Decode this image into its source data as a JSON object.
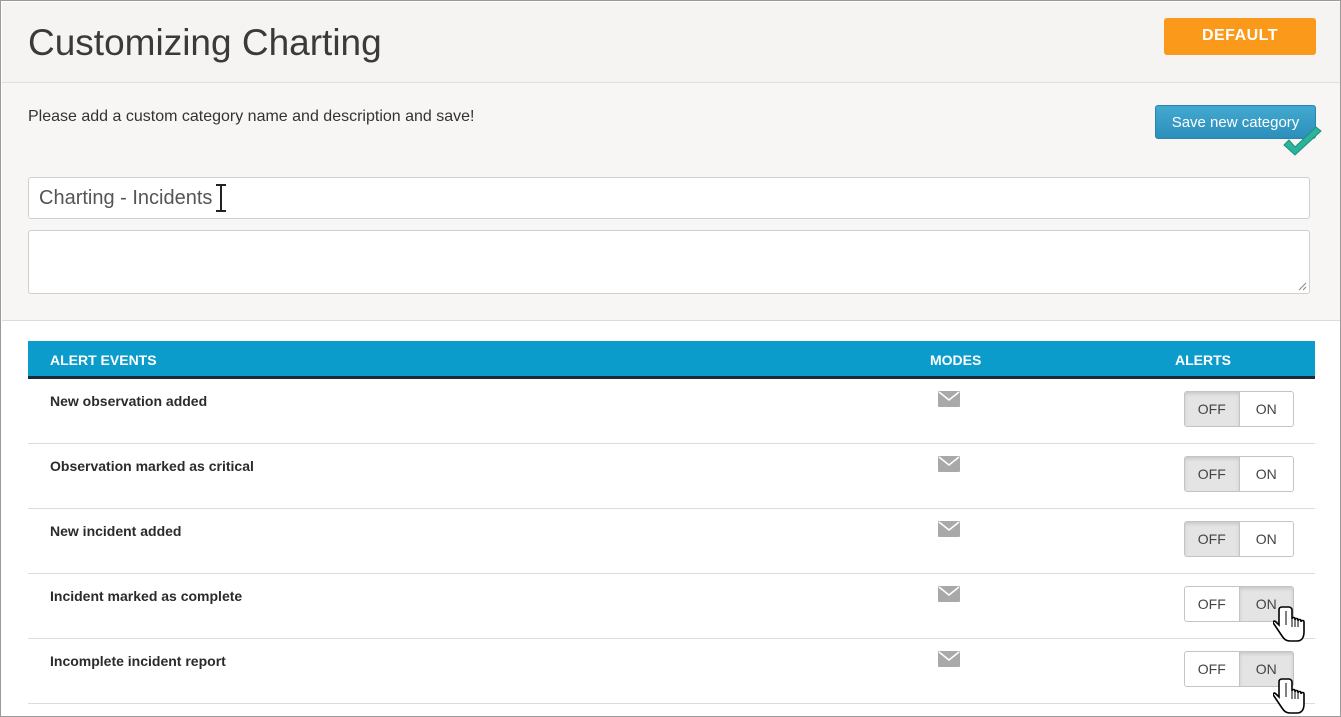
{
  "header": {
    "title": "Customizing Charting",
    "default_button": "DEFAULT"
  },
  "form": {
    "instructions": "Please add a custom category name and description and save!",
    "save_button": "Save new category",
    "name_value": "Charting - Incidents",
    "description_value": ""
  },
  "table": {
    "columns": {
      "events": "ALERT EVENTS",
      "modes": "MODES",
      "alerts": "ALERTS"
    },
    "rows": [
      {
        "label": "New observation added",
        "mode_icon": "envelope-icon",
        "off_label": "OFF",
        "on_label": "ON",
        "selected": "OFF"
      },
      {
        "label": "Observation marked as critical",
        "mode_icon": "envelope-icon",
        "off_label": "OFF",
        "on_label": "ON",
        "selected": "OFF"
      },
      {
        "label": "New incident added",
        "mode_icon": "envelope-icon",
        "off_label": "OFF",
        "on_label": "ON",
        "selected": "OFF"
      },
      {
        "label": "Incident marked as complete",
        "mode_icon": "envelope-icon",
        "off_label": "OFF",
        "on_label": "ON",
        "selected": "ON"
      },
      {
        "label": "Incomplete incident report",
        "mode_icon": "envelope-icon",
        "off_label": "OFF",
        "on_label": "ON",
        "selected": "ON"
      }
    ]
  },
  "colors": {
    "accent_blue": "#0c9ccc",
    "default_orange": "#fb9a1a",
    "save_blue": "#2b8fbb",
    "check_green": "#29b39b"
  }
}
